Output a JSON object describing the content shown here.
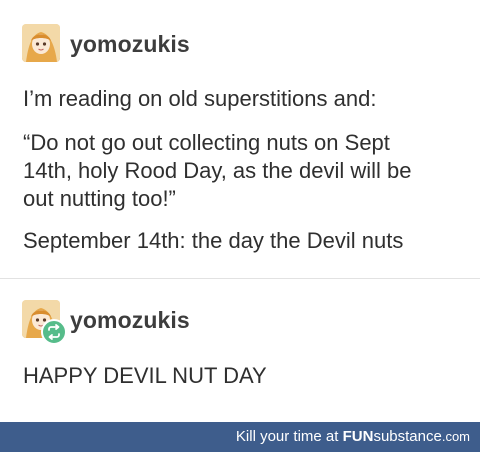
{
  "posts": [
    {
      "username": "yomozukis",
      "lines": [
        "I’m reading on old superstitions and:",
        "“Do not go out collecting nuts on Sept",
        "14th, holy Rood Day, as the devil will be",
        "out nutting too!”",
        "September 14th: the day the Devil nuts"
      ]
    },
    {
      "username": "yomozukis",
      "lines": [
        "HAPPY DEVIL NUT DAY"
      ]
    }
  ],
  "footer": {
    "prefix": "Kill your time at ",
    "brand_bold": "FUN",
    "brand_regular": "substance",
    "brand_domain": ".com"
  },
  "colors": {
    "footer_bg": "#3e5d8c",
    "reblog_badge": "#56bc8a",
    "divider": "#e2e2e2"
  },
  "icons": [
    "avatar",
    "reblog-icon"
  ]
}
